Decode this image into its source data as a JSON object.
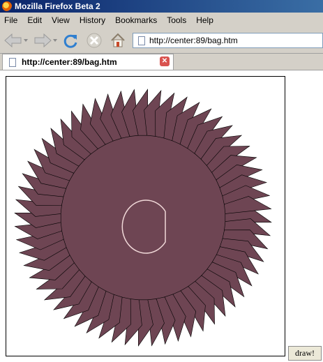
{
  "window": {
    "title": "Mozilla Firefox Beta 2"
  },
  "menu": {
    "items": [
      "File",
      "Edit",
      "View",
      "History",
      "Bookmarks",
      "Tools",
      "Help"
    ]
  },
  "navigation": {
    "url": "http://center:89/bag.htm",
    "icons": [
      "back-icon",
      "forward-icon",
      "reload-icon",
      "stop-icon",
      "home-icon"
    ]
  },
  "tabs": [
    {
      "title": "http://center:89/bag.htm"
    }
  ],
  "page": {
    "draw_button_label": "draw!",
    "drawing": {
      "spike_color": "#6e4553",
      "outline_color": "#000000",
      "inner_arc_color": "#f0d8d8",
      "spike_count": 60
    }
  }
}
